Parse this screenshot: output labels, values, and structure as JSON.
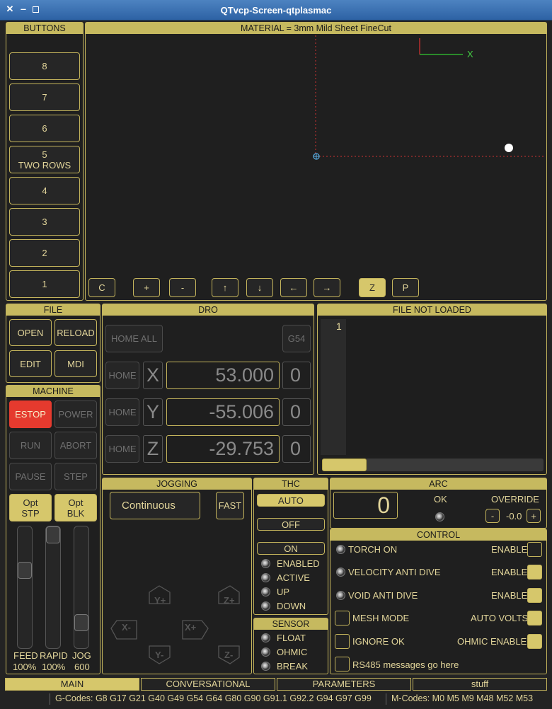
{
  "window": {
    "title": "QTvcp-Screen-qtplasmac"
  },
  "buttons_panel": {
    "title": "BUTTONS",
    "items": [
      "8",
      "7",
      "6",
      "5\nTWO ROWS",
      "4",
      "3",
      "2",
      "1"
    ]
  },
  "preview": {
    "title": "MATERIAL = 3mm Mild Sheet FineCut",
    "axis_label": "X",
    "controls": [
      "C",
      "+",
      "-",
      "↑",
      "↓",
      "←",
      "→",
      "Z",
      "P"
    ]
  },
  "file": {
    "title": "FILE",
    "open": "OPEN",
    "reload": "RELOAD",
    "edit": "EDIT",
    "mdi": "MDI"
  },
  "machine": {
    "title": "MACHINE",
    "estop": "ESTOP",
    "power": "POWER",
    "run": "RUN",
    "abort": "ABORT",
    "pause": "PAUSE",
    "step": "STEP",
    "opt_stp": "Opt\nSTP",
    "opt_blk": "Opt\nBLK"
  },
  "sliders": {
    "feed_label": "FEED",
    "feed_value": "100%",
    "rapid_label": "RAPID",
    "rapid_value": "100%",
    "jog_label": "JOG",
    "jog_value": "600"
  },
  "dro": {
    "title": "DRO",
    "home_all": "HOME ALL",
    "coord_system": "G54",
    "axes": [
      {
        "home": "HOME",
        "axis": "X",
        "value": "53.000",
        "offset": "0"
      },
      {
        "home": "HOME",
        "axis": "Y",
        "value": "-55.006",
        "offset": "0"
      },
      {
        "home": "HOME",
        "axis": "Z",
        "value": "-29.753",
        "offset": "0"
      }
    ]
  },
  "gcode": {
    "title": "FILE NOT LOADED",
    "line_number": "1",
    "progress": 0.2
  },
  "jogging": {
    "title": "JOGGING",
    "mode": "Continuous",
    "fast": "FAST",
    "y_plus": "Y+",
    "y_minus": "Y-",
    "x_plus": "X+",
    "x_minus": "X-",
    "z_plus": "Z+",
    "z_minus": "Z-"
  },
  "thc": {
    "title": "THC",
    "auto": "AUTO",
    "off": "OFF",
    "on": "ON",
    "enabled": "ENABLED",
    "active": "ACTIVE",
    "up": "UP",
    "down": "DOWN"
  },
  "sensor": {
    "title": "SENSOR",
    "float": "FLOAT",
    "ohmic": "OHMIC",
    "break": "BREAK"
  },
  "arc": {
    "title": "ARC",
    "value": "0",
    "ok": "OK",
    "override": "OVERRIDE",
    "minus": "-",
    "plus": "+",
    "override_value": "-0.0"
  },
  "control": {
    "title": "CONTROL",
    "torch_on": "TORCH ON",
    "velocity_anti_dive": "VELOCITY ANTI DIVE",
    "void_anti_dive": "VOID ANTI DIVE",
    "mesh_mode": "MESH MODE",
    "ignore_ok": "IGNORE OK",
    "rs485": "RS485 messages go here",
    "enable": "ENABLE",
    "auto_volts": "AUTO VOLTS",
    "ohmic_enable": "OHMIC ENABLE"
  },
  "tabs": [
    "MAIN",
    "CONVERSATIONAL",
    "PARAMETERS",
    "stuff"
  ],
  "status": {
    "gcodes": "G-Codes: G8 G17 G21 G40 G49 G54 G64 G80 G90 G91.1 G92.2 G94 G97 G99",
    "mcodes": "M-Codes: M0 M5 M9 M48 M52 M53"
  }
}
